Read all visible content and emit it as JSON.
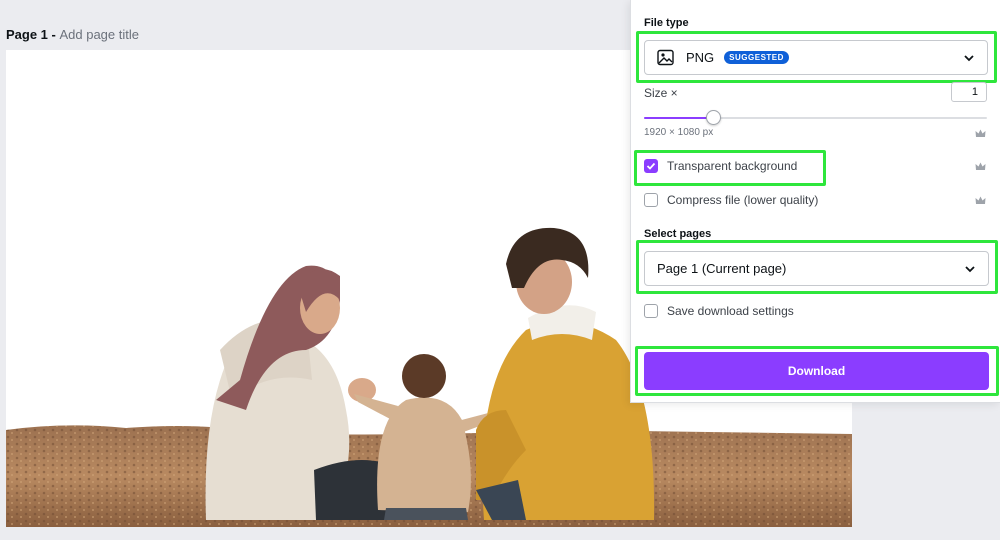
{
  "page": {
    "number_label": "Page 1 - ",
    "add_title_placeholder": "Add page title"
  },
  "download_panel": {
    "file_type": {
      "label": "File type",
      "selected": "PNG",
      "badge": "SUGGESTED",
      "icon": "image-icon"
    },
    "size": {
      "label": "Size ×",
      "value": "1",
      "dimensions": "1920 × 1080 px",
      "slider_fraction": 0.2
    },
    "options": {
      "transparent_background": {
        "label": "Transparent background",
        "checked": true,
        "premium": true
      },
      "compress_file": {
        "label": "Compress file (lower quality)",
        "checked": false,
        "premium": true
      }
    },
    "select_pages": {
      "label": "Select pages",
      "selected": "Page 1 (Current page)"
    },
    "save_settings": {
      "label": "Save download settings",
      "checked": false
    },
    "download_label": "Download"
  },
  "colors": {
    "accent": "#8b3dff",
    "badge": "#0f60d8",
    "highlight": "#2ee63c",
    "workspace": "#ebecf0"
  }
}
